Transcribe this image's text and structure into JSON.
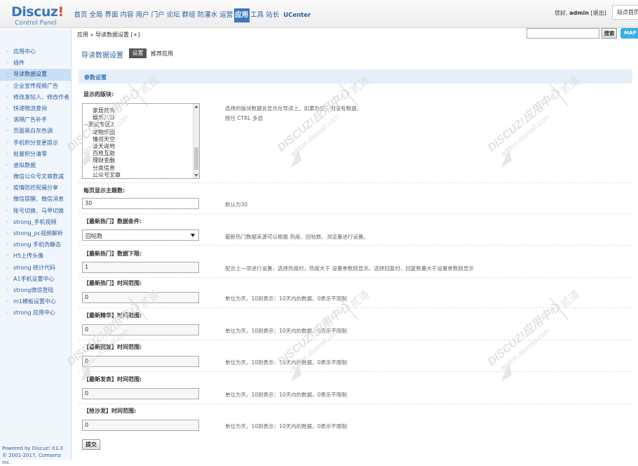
{
  "header": {
    "brand": "Discuz",
    "brand_bang": "!",
    "subtitle": "Control Panel",
    "nav": [
      "首页",
      "全局",
      "界面",
      "内容",
      "用户",
      "门户",
      "论坛",
      "群组",
      "防灌水",
      "运营",
      "应用",
      "工具",
      "站长",
      "UCenter"
    ],
    "active_nav": "应用",
    "greeting": "您好,",
    "username": "admin",
    "logout": "[退出]",
    "site_home": "站点首页"
  },
  "subbar": {
    "breadcrumb": "应用 » 导读数据设置 [+]",
    "search_button": "搜索",
    "map_button": "MAP"
  },
  "sidebar": {
    "items": [
      "应用中心",
      "插件",
      "导读数据设置",
      "企业宣传视频广告",
      "修改发帖人、修改作者",
      "快递物流查询",
      "滚隔广告补手",
      "页面黑白灰色调",
      "手机积分变更提示",
      "批量积分清零",
      "虚拟数据",
      "微信公众号文章数减",
      "疫情防控祝福分享",
      "微信提醒、微信消息",
      "账号切换、马甲切换",
      "strong_手机视频",
      "strong_pc视频解析",
      "strong 手机伪静态",
      "H5上传头像",
      "strong 统计代码",
      "A1手机设置中心",
      "strong微信登陆",
      "m1模板设置中心",
      "strong 应用中心"
    ],
    "active_index": 2,
    "footer_line1": "Powered by Discuz! X3.3",
    "footer_line2": "© 2001-2017, Comsenz Inc."
  },
  "main": {
    "title": "导读数据设置",
    "tab_settings": "设置",
    "tab_recommend": "推荐应用",
    "section_title": "参数设置",
    "board_label": "显示的版块:",
    "board_hint_1": "选择的版块数据会显示在导读上，如果为空，则没有数据。",
    "board_hint_2": "按住 CTRL 多选",
    "board_options": [
      {
        "text": "家居装饰",
        "group": false
      },
      {
        "text": "娱乐八卦",
        "group": false
      },
      {
        "text": "--测试专区2",
        "group": true
      },
      {
        "text": "宠物乐园",
        "group": false
      },
      {
        "text": "情感天空",
        "group": false
      },
      {
        "text": "谈天说地",
        "group": false
      },
      {
        "text": "百姓互助",
        "group": false
      },
      {
        "text": "理财金融",
        "group": false
      },
      {
        "text": "分类信息",
        "group": false
      },
      {
        "text": "公众号文章",
        "group": false
      }
    ],
    "per_page_label": "每页显示主题数:",
    "per_page_value": "30",
    "per_page_hint": "默认为30",
    "hot_cond_label": "【最新热门】数据条件:",
    "hot_cond_value": "回帖数",
    "hot_cond_hint": "最新热门数据来源可以根据 热度、回帖数、浏览量进行设置。",
    "hot_min_label": "【最新热门】数据下限:",
    "hot_min_value": "1",
    "hot_min_hint": "配合上一项进行设置，选择热度时，热度大于 设置参数则显示。选择回复时，回复数量大于设置参数则显示",
    "time_fields": [
      {
        "label": "【最新热门】时间范围:",
        "value": "0",
        "hint": "单位为天，10则表示：10天内的数据，0表示不限制"
      },
      {
        "label": "【最新精华】时间范围:",
        "value": "0",
        "hint": "单位为天，10则表示：10天内的数据，0表示不限制"
      },
      {
        "label": "【最新回复】时间范围:",
        "value": "0",
        "hint": "单位为天，10则表示：10天内的数据，0表示不限制"
      },
      {
        "label": "【最新发表】时间范围:",
        "value": "0",
        "hint": "单位为天，10则表示：10天内的数据，0表示不限制"
      },
      {
        "label": "【抢沙发】时间范围:",
        "value": "0",
        "hint": "单位为天，10则表示：10天内的数据，0表示不限制"
      }
    ],
    "submit": "提交"
  },
  "watermark": {
    "brand": "DISCUZ!应用中心",
    "url": "addon.dismall.com",
    "name": "贰道"
  },
  "colors": {
    "link": "#2b5e9e",
    "active_nav_bg": "#3a78c0",
    "section_bg": "#e4eff9",
    "sidebar_bg": "#f1f6fc",
    "map_button": "#3ab0e6"
  }
}
